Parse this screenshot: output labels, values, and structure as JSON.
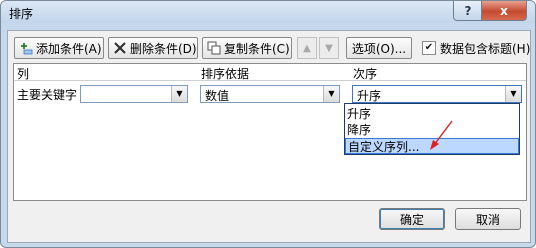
{
  "window": {
    "title": "排序",
    "help_label": "?",
    "close_label": "x"
  },
  "toolbar": {
    "add_label": "添加条件(A)",
    "delete_label": "删除条件(D)",
    "copy_label": "复制条件(C)",
    "options_label": "选项(O)...",
    "header_checkbox_label": "数据包含标题(H)",
    "header_checkbox_checked": true
  },
  "grid": {
    "columns": [
      "列",
      "排序依据",
      "次序"
    ],
    "row": {
      "label": "主要关键字",
      "column_value": "",
      "sort_on_value": "数值",
      "order_value": "升序"
    }
  },
  "order_dropdown": {
    "options": [
      "升序",
      "降序",
      "自定义序列..."
    ],
    "selected_index": 2
  },
  "annotation": {
    "arrow_color": "#e02020"
  },
  "footer": {
    "ok_label": "确定",
    "cancel_label": "取消"
  },
  "colors": {
    "selection": "#bcd8ff",
    "title_gradient": "#c2d5ea",
    "close": "#c44a30"
  }
}
